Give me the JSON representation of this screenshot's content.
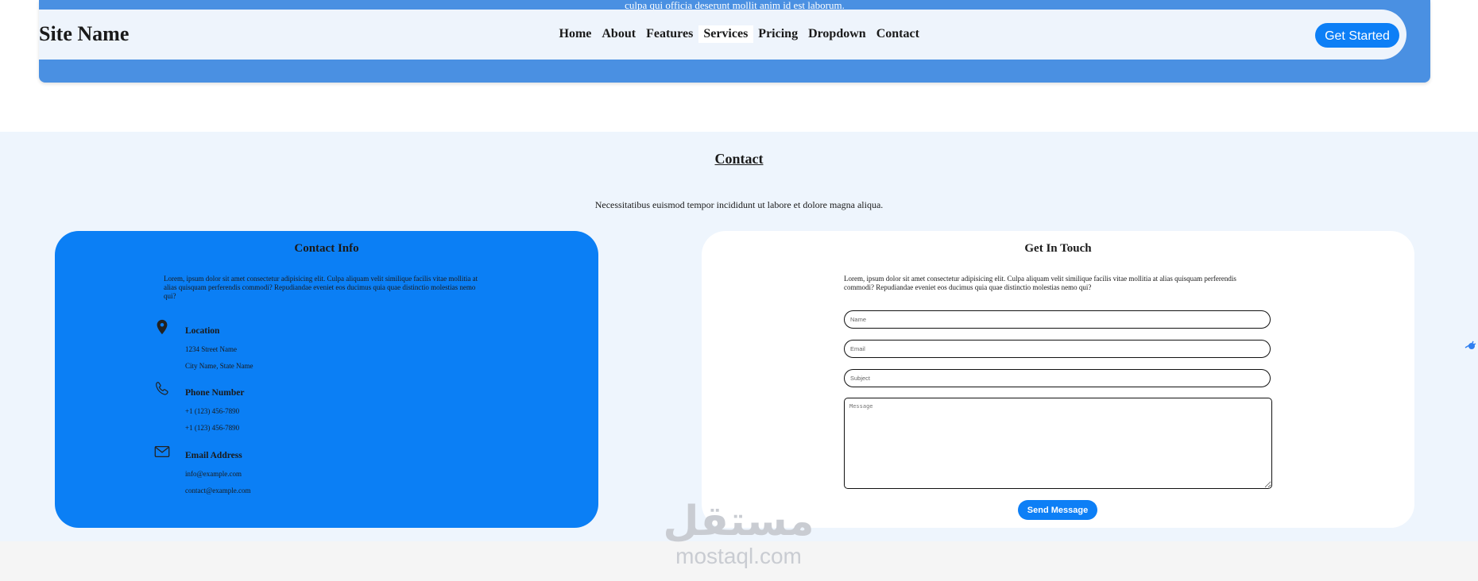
{
  "header": {
    "overflow_text": "culpa qui officia deserunt mollit anim id est laborum.",
    "site_name": "Site Name",
    "nav_items": [
      "Home",
      "About",
      "Features",
      "Services",
      "Pricing",
      "Dropdown",
      "Contact"
    ],
    "active_nav": "Services",
    "cta_label": "Get Started"
  },
  "contact": {
    "title": "Contact",
    "subtitle": "Necessitatibus euismod tempor incididunt ut labore et dolore magna aliqua.",
    "info_card": {
      "heading": "Contact Info",
      "description": "Lorem, ipsum dolor sit amet consectetur adipisicing elit. Culpa aliquam velit similique facilis vitae mollitia at alias quisquam perferendis commodi? Repudiandae eveniet eos ducimus quia quae distinctio molestias nemo qui?",
      "items": [
        {
          "icon": "map-pin-icon",
          "title": "Location",
          "lines": [
            "1234 Street Name",
            "City Name, State Name"
          ]
        },
        {
          "icon": "phone-icon",
          "title": "Phone Number",
          "lines": [
            "+1 (123) 456-7890",
            "+1 (123) 456-7890"
          ]
        },
        {
          "icon": "envelope-icon",
          "title": "Email Address",
          "lines": [
            "info@example.com",
            "contact@example.com"
          ]
        }
      ]
    },
    "form_card": {
      "heading": "Get In Touch",
      "description": "Lorem, ipsum dolor sit amet consectetur adipisicing elit. Culpa aliquam velit similique facilis vitae mollitia at alias quisquam perferendis commodi? Repudiandae eveniet eos ducimus quia quae distinctio molestias nemo qui?",
      "name_placeholder": "Name",
      "email_placeholder": "Email",
      "subject_placeholder": "Subject",
      "message_placeholder": "Message",
      "submit_label": "Send Message"
    }
  },
  "watermark": {
    "arabic": "مستقل",
    "latin": "mostaql.com"
  },
  "colors": {
    "header_band": "#4a90e2",
    "navbar": "#eef4fc",
    "accent": "#0d7ff6",
    "section_bg": "#eef5fd"
  }
}
